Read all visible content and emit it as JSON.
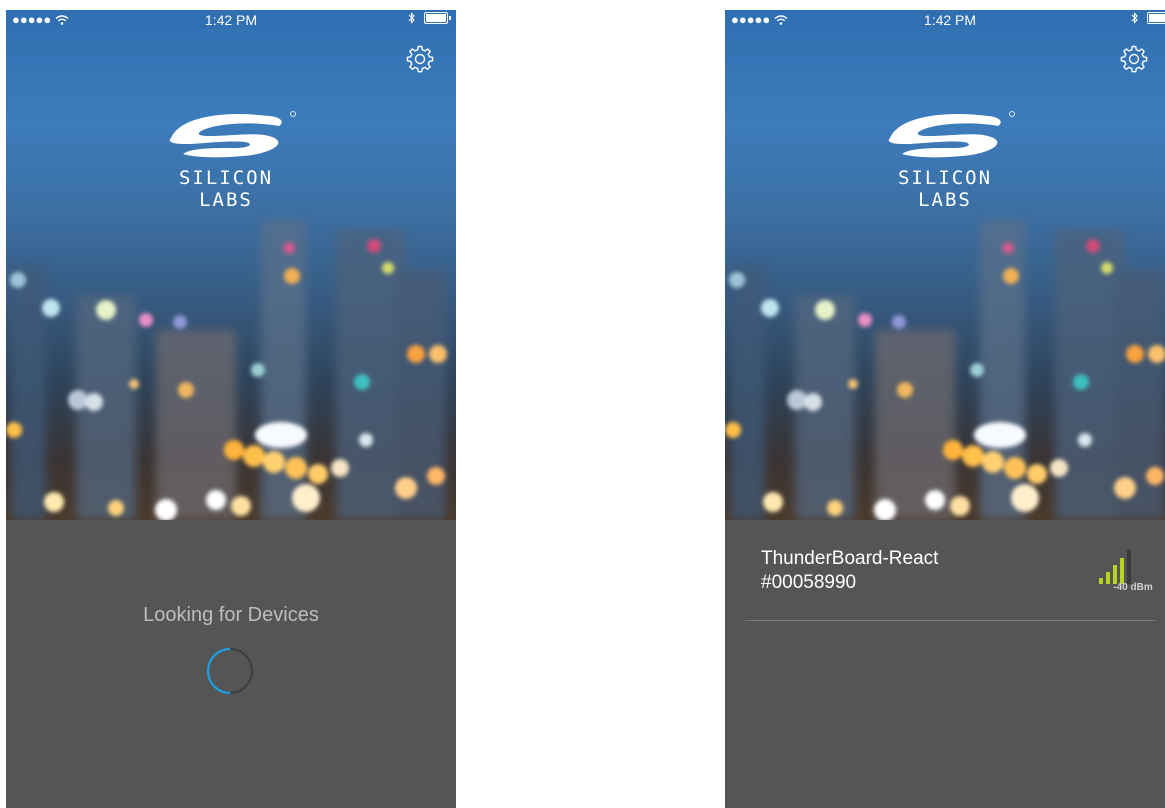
{
  "screens": [
    {
      "status": {
        "signal_dots": "●●●●●",
        "time": "1:42 PM"
      },
      "brand": {
        "name": "SILICON LABS"
      },
      "state": "scanning",
      "loading_text": "Looking for Devices"
    },
    {
      "status": {
        "signal_dots": "●●●●●",
        "time": "1:42 PM"
      },
      "brand": {
        "name": "SILICON LABS"
      },
      "state": "device-found",
      "device": {
        "name": "ThunderBoard-React",
        "id": "#00058990",
        "rssi": "-40 dBm"
      }
    }
  ],
  "icons": [
    "wifi-icon",
    "bluetooth-icon",
    "battery-icon",
    "settings-gear-icon",
    "signal-strength-icon",
    "loading-spinner-icon"
  ],
  "colors": {
    "panel": "#555555",
    "spinner": "#1e9fe0",
    "signal_active": "#b6d31e",
    "signal_inactive": "#3b3b3b",
    "loading_text": "#bdbdbd"
  }
}
